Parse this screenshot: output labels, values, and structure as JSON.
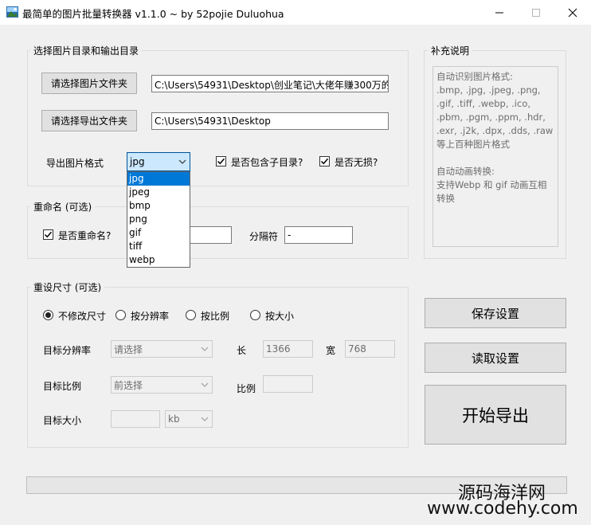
{
  "window": {
    "title": "最简单的图片批量转换器 v1.1.0 ~ by 52pojie Duluohua"
  },
  "source_group": {
    "title": "选择图片目录和输出目录",
    "choose_input_button": "请选择图片文件夹",
    "input_path": "C:\\Users\\54931\\Desktop\\创业笔记\\大佬年赚300万的",
    "choose_output_button": "请选择导出文件夹",
    "output_path": "C:\\Users\\54931\\Desktop",
    "format_label": "导出图片格式",
    "format_selected": "jpg",
    "format_options": [
      "jpg",
      "jpeg",
      "bmp",
      "png",
      "gif",
      "tiff",
      "webp"
    ],
    "include_subdirs_label": "是否包含子目录?",
    "include_subdirs_checked": true,
    "lossless_label": "是否无损?",
    "lossless_checked": true
  },
  "rename_group": {
    "title": "重命名 (可选)",
    "rename_label": "是否重命名?",
    "rename_checked": true,
    "name_value": "",
    "separator_label": "分隔符",
    "separator_value": "-"
  },
  "resize_group": {
    "title": "重设尺寸 (可选)",
    "radio_options": [
      "不修改尺寸",
      "按分辨率",
      "按比例",
      "按大小"
    ],
    "radio_selected": "不修改尺寸",
    "target_resolution_label": "目标分辨率",
    "resolution_placeholder": "请选择",
    "length_label": "长",
    "length_value": "1366",
    "width_label": "宽",
    "width_value": "768",
    "target_ratio_label": "目标比例",
    "ratio_placeholder": "前选择",
    "ratio_label": "比例",
    "ratio_value": "",
    "target_size_label": "目标大小",
    "size_value": "",
    "size_unit": "kb"
  },
  "notes": {
    "title": "补充说明",
    "text": "自动识别图片格式:\n.bmp, .jpg, .jpeg, .png,\n.gif, .tiff, .webp, .ico,\n.pbm, .pgm, .ppm, .hdr,\n.exr, .j2k, .dpx, .dds, .raw\n等上百种图片格式\n\n自动动画转换:\n支持Webp 和 gif 动画互相\n转换"
  },
  "actions": {
    "save_settings": "保存设置",
    "load_settings": "读取设置",
    "start_export": "开始导出"
  },
  "progress": {
    "value": 0
  },
  "watermark": {
    "line1": "源码海洋网",
    "line2": "www.codehy.com"
  }
}
